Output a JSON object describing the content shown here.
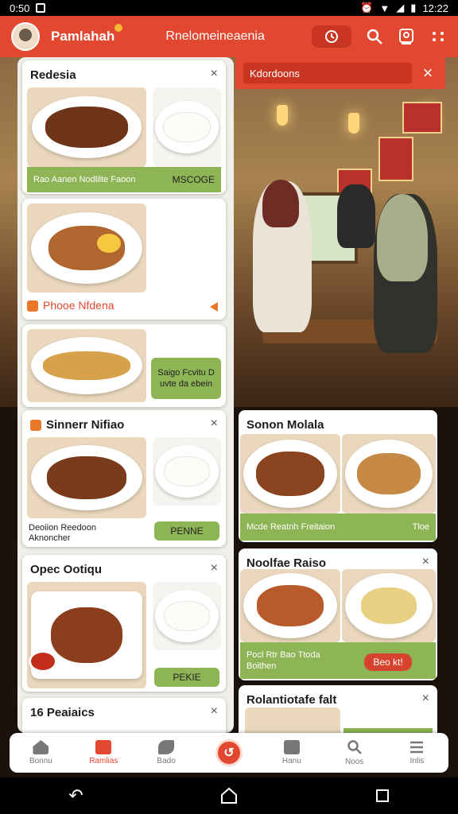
{
  "status_bar": {
    "time_left": "0:50",
    "time_right": "12:22"
  },
  "app_bar": {
    "brand": "Pamlahah",
    "subtitle": "Rnelomeineaenia"
  },
  "banner": {
    "text": "Kdordoons"
  },
  "cards": {
    "c1": {
      "title": "Redesia",
      "bar_text": "Rao Aanen Nodlilte Faoon",
      "bar_button": "MSCOGE"
    },
    "c2": {
      "footer": "Phooe Nfdena"
    },
    "c3": {
      "button": "Saigo Fcvitu D uvte da ebein"
    },
    "c4": {
      "title": "Sinnerr Nifiao",
      "caption": "Deoiion Reedoon Aknoncher",
      "button": "PENNE"
    },
    "c5": {
      "title": "Opec Ootiqu",
      "button": "PEKIE"
    },
    "c6": {
      "title": "16 Peaiaics"
    },
    "r1": {
      "title": "Sonon Molala",
      "bar_text": "Mcde Reatnh Freitaion",
      "bar_right": "Tloe"
    },
    "r2": {
      "title": "Noolfae Raiso",
      "bar_text": "Pocl Rtr Bao Ttoda Boithen",
      "red_button": "Beo kt!"
    },
    "r3": {
      "title": "Rolantiotafe falt"
    }
  },
  "bottom_nav": [
    {
      "label": "Bonnu",
      "active": false
    },
    {
      "label": "Ramlias",
      "active": true
    },
    {
      "label": "Bado",
      "active": false
    },
    {
      "label": "",
      "active": false
    },
    {
      "label": "Hanu",
      "active": false
    },
    {
      "label": "Noos",
      "active": false
    },
    {
      "label": "Inlis",
      "active": false
    }
  ],
  "colors": {
    "brand_red": "#e2472f",
    "accent_green": "#8db555",
    "orange": "#e8792b"
  }
}
